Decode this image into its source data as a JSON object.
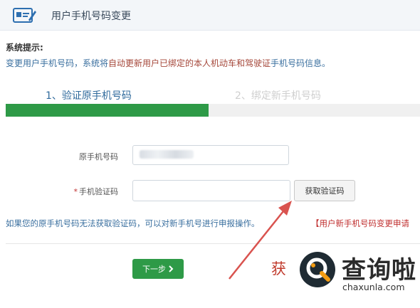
{
  "header": {
    "title": "用户手机号码变更",
    "icon": "id-card-icon"
  },
  "tips": {
    "heading": "系统提示:",
    "line_pre": "变更用户手机号码，系统将",
    "line_hl": "自动更新用户已绑定的本人机动车和驾驶证",
    "line_post": "手机号码信息。"
  },
  "steps": [
    {
      "label": "1、验证原手机号码",
      "state": "active"
    },
    {
      "label": "2、绑定新手机号码",
      "state": "inactive"
    }
  ],
  "progress": {
    "fraction": 0.49,
    "color": "#2e9a47"
  },
  "form": {
    "original_phone_label": "原手机号码",
    "original_phone_value_state": "masked",
    "code_required_mark": "*",
    "code_label": "手机验证码",
    "code_value": "",
    "get_code_label": "获取验证码"
  },
  "note": {
    "text": "如果您的原手机号码无法获取验证码，可以对新手机号进行申报操作。",
    "link": "【用户新手机号码变更申请"
  },
  "next_button": {
    "label": "下一步",
    "icon": "chevron-right-icon"
  },
  "peek_text": "获",
  "watermark": {
    "title": "查询啦",
    "domain": "chaxunla.com",
    "logo": "magnifier-logo"
  },
  "colors": {
    "accent_green": "#2e9a47",
    "link_blue": "#3a6f9f",
    "warning_red": "#c03030"
  }
}
